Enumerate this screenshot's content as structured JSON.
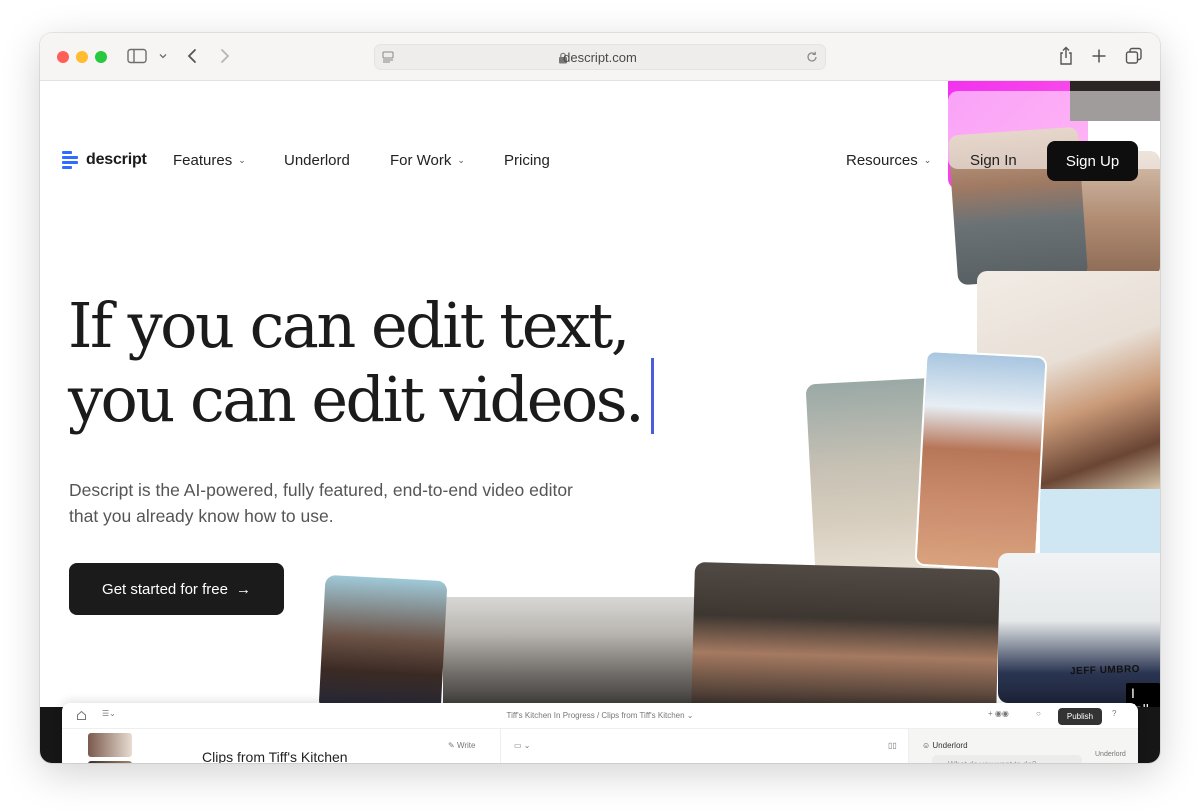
{
  "browser": {
    "url": "descript.com"
  },
  "nav": {
    "logo_text": "descript",
    "items": [
      {
        "label": "Features",
        "has_dropdown": true
      },
      {
        "label": "Underlord",
        "has_dropdown": false
      },
      {
        "label": "For Work",
        "has_dropdown": true
      },
      {
        "label": "Pricing",
        "has_dropdown": false
      }
    ],
    "resources_label": "Resources",
    "sign_in_label": "Sign In",
    "sign_up_label": "Sign Up"
  },
  "hero": {
    "title_line1": "If you can edit text,",
    "title_line2": "you can edit videos.",
    "subtitle_line1": "Descript is the AI-powered, fully featured, end-to-end video editor",
    "subtitle_line2": "that you already know how to use.",
    "cta_label": "Get started for free",
    "cta_arrow": "→"
  },
  "collage": {
    "caption_name": "JEFF UMBRO",
    "caption_subtitle": "I fell"
  },
  "app_preview": {
    "breadcrumb": "Tiff's Kitchen In Progress  /  Clips from Tiff's Kitchen ⌄",
    "write_label": "Write",
    "publish_label": "Publish",
    "clip_title": "Clips from Tiff's Kitchen",
    "underlord_label": "Underlord",
    "ask_placeholder": "What do you want to do?",
    "side_underlord_label": "Underlord"
  },
  "colors": {
    "accent_caret": "#4b5dde",
    "cta_bg": "#1b1b1b",
    "logo_blue": "#2f6bff"
  }
}
